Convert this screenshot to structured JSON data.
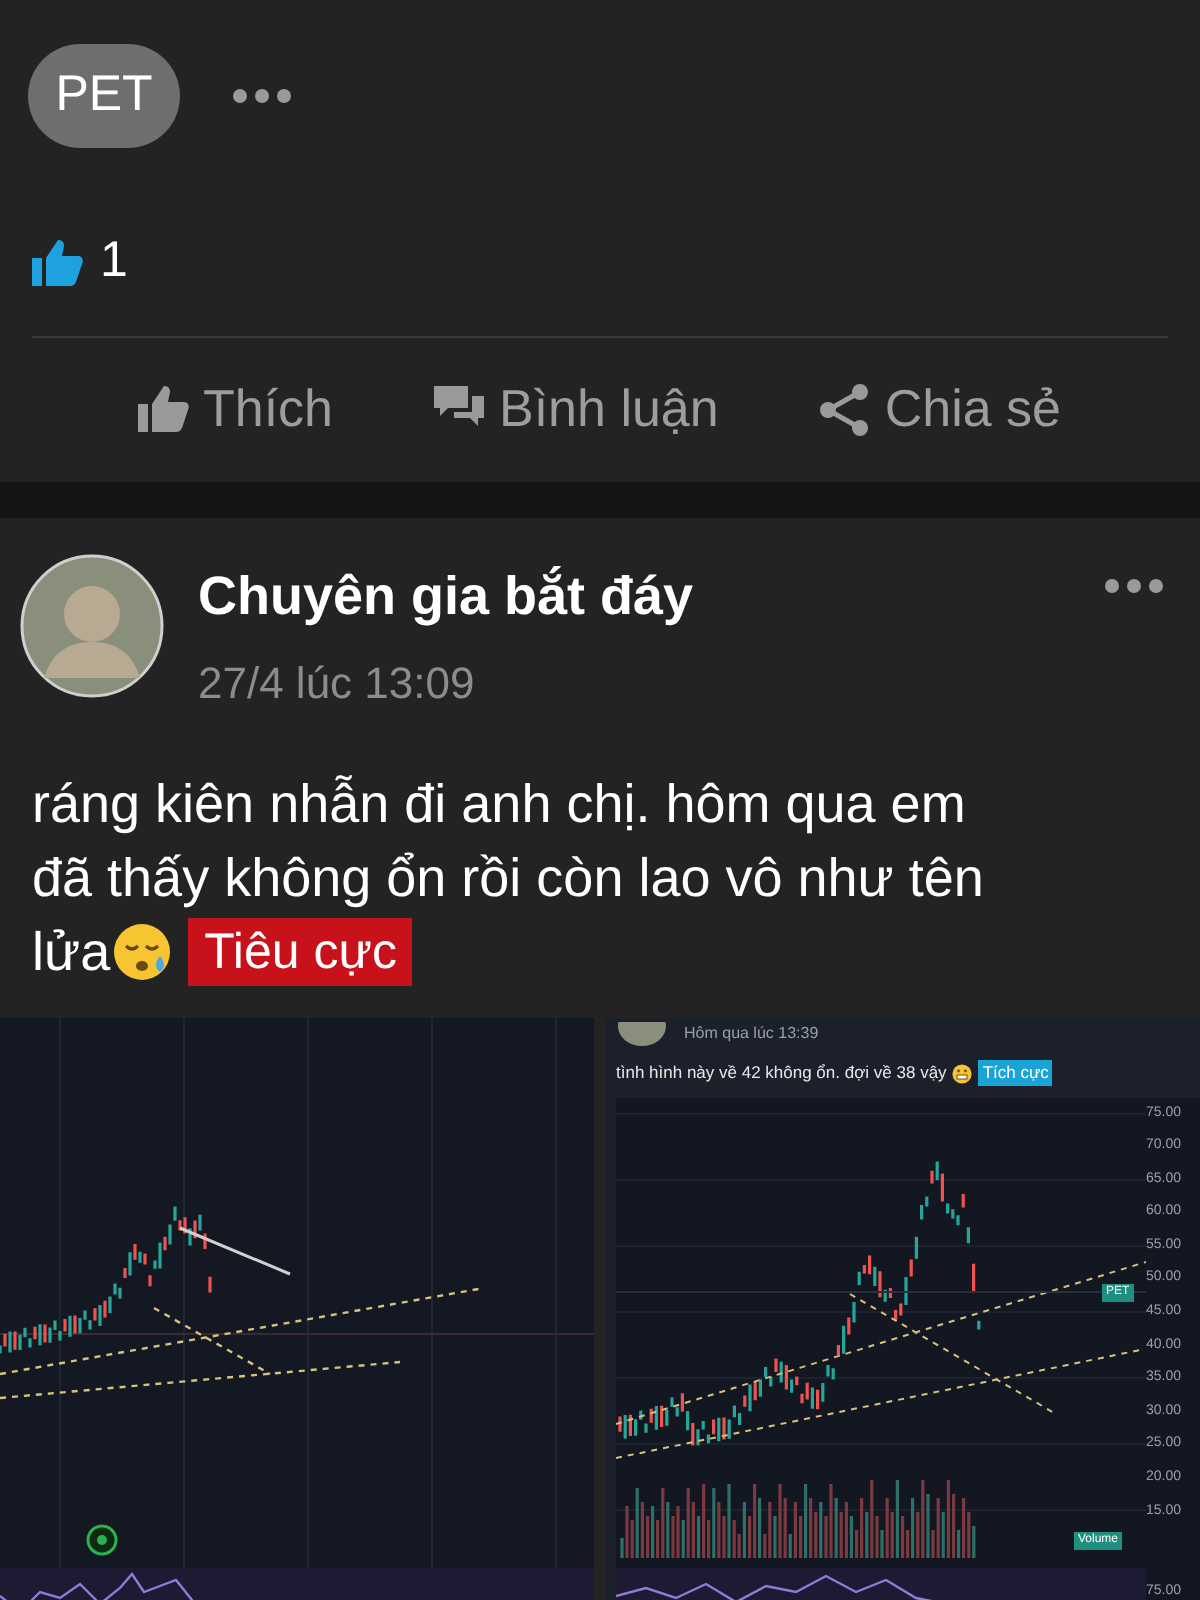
{
  "prev_post": {
    "ticker_chip": "PET",
    "reactions": {
      "count": "1"
    },
    "actions": [
      {
        "kind": "like",
        "label": "Thích"
      },
      {
        "kind": "comment",
        "label": "Bình luận"
      },
      {
        "kind": "share",
        "label": "Chia sẻ"
      }
    ]
  },
  "post": {
    "author": "Chuyên gia bắt đáy",
    "time": "27/4 lúc 13:09",
    "text_lines": [
      "ráng kiên nhẫn đi anh chị. hôm qua em",
      "đã thấy không ổn rồi còn lao vô như tên",
      "lửa"
    ],
    "sentiment": {
      "kind": "negative",
      "label": "Tiêu cực"
    },
    "images": [
      {
        "kind": "chart"
      },
      {
        "kind": "post_screenshot",
        "time": "Hôm qua lúc 13:39",
        "text": "tình hình này về 42 không ổn. đợi về 38 vậy",
        "sentiment": {
          "kind": "positive",
          "label": "Tích cực"
        },
        "price_labels": [
          "75.00",
          "70.00",
          "65.00",
          "60.00",
          "55.00",
          "50.00",
          "45.00",
          "40.00",
          "35.00",
          "30.00",
          "25.00",
          "20.00",
          "15.00"
        ],
        "price_marker": "PET",
        "volume_label": "Volume",
        "oscillator_label": "75.00"
      }
    ]
  }
}
